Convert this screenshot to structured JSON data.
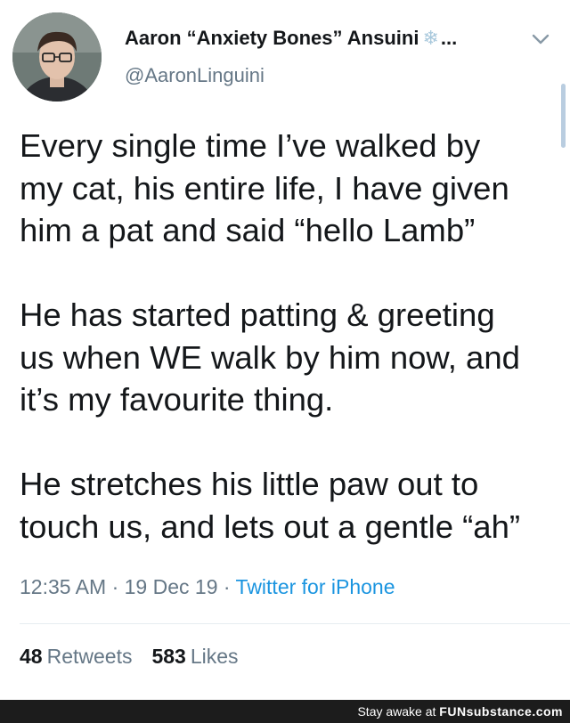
{
  "author": {
    "display_name": "Aaron “Anxiety Bones” Ansuini",
    "name_emoji": "❄",
    "truncation": "...",
    "handle": "@AaronLinguini",
    "avatar_icon": "profile-photo"
  },
  "tweet": {
    "paragraphs": [
      [
        "Every single time I’ve walked by",
        "my cat, his entire life, I have given",
        "him a pat and said “hello Lamb”"
      ],
      [
        "He has started patting & greeting",
        "us when WE walk by him now, and",
        "it’s my favourite thing."
      ],
      [
        "He stretches his little paw out to",
        "touch us, and lets out a gentle “ah”"
      ]
    ]
  },
  "meta": {
    "time": "12:35 AM",
    "separator": "·",
    "date": "19 Dec 19",
    "source": "Twitter for iPhone"
  },
  "stats": {
    "retweets_count": "48",
    "retweets_label": "Retweets",
    "likes_count": "583",
    "likes_label": "Likes"
  },
  "watermark": {
    "prefix": "Stay awake at",
    "brand": "FUNsubstance.com"
  },
  "colors": {
    "text": "#14171a",
    "secondary": "#657786",
    "link": "#1b95e0",
    "divider": "#e6ecf0"
  }
}
